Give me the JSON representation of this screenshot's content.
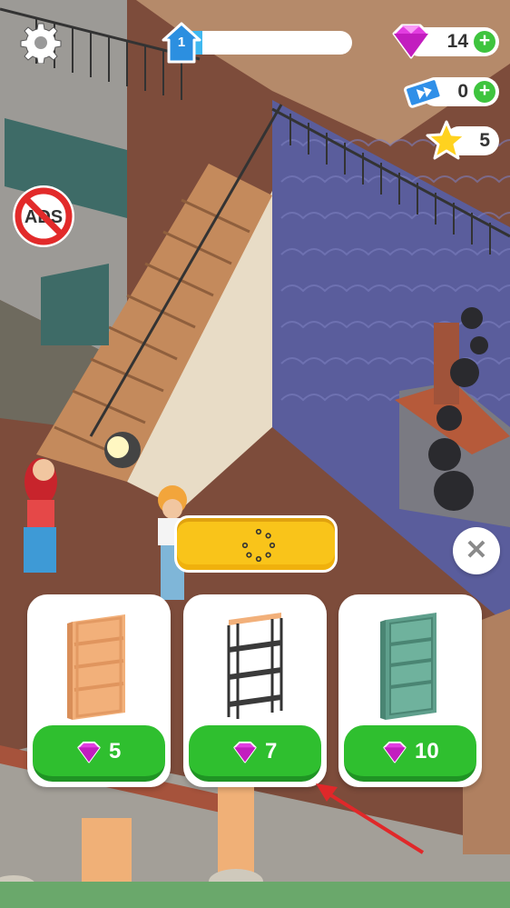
{
  "hud": {
    "level": "1",
    "level_progress": 0.12,
    "gems": "14",
    "tickets": "0",
    "stars": "5"
  },
  "popup": {
    "loading_state": "loading"
  },
  "shop_items": [
    {
      "name": "wooden-bookshelf",
      "price": "5",
      "color": "#f2b07a"
    },
    {
      "name": "metal-shelf-rack",
      "price": "7",
      "color": "#3a3a3a"
    },
    {
      "name": "teal-bookcase",
      "price": "10",
      "color": "#5f9f8c"
    }
  ],
  "colors": {
    "accent_yellow": "#f9c41a",
    "buy_green": "#2fbf2f",
    "gem_pink": "#e23de0",
    "level_blue": "#3fb8f0"
  },
  "icons": {
    "settings": "gear-icon",
    "level": "house-level-icon",
    "gems": "gem-icon",
    "tickets": "ticket-icon",
    "stars": "star-icon",
    "no_ads": "no-ads-icon",
    "close": "close-icon",
    "spinner": "loading-spinner-icon"
  }
}
